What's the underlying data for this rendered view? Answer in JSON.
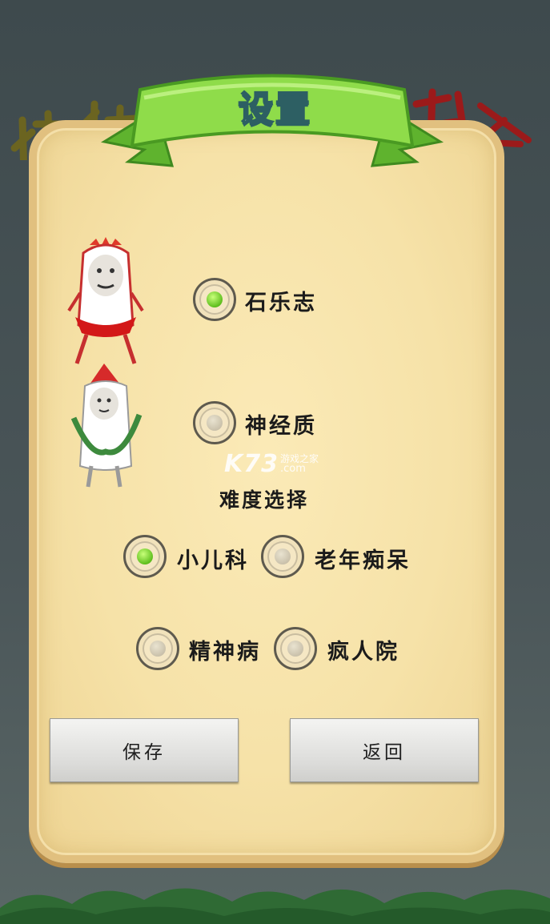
{
  "title": "设置",
  "background_text": "精神病人游戏",
  "characters": [
    {
      "name": "石乐志",
      "icon": "radish-character-crown-icon",
      "selected": true
    },
    {
      "name": "神经质",
      "icon": "radish-character-hat-icon",
      "selected": false
    }
  ],
  "watermark": {
    "brand": "K73",
    "tagline": "游戏之家",
    "domain": ".com"
  },
  "difficulty": {
    "heading": "难度选择",
    "options": [
      {
        "label": "小儿科",
        "selected": true
      },
      {
        "label": "老年痴呆",
        "selected": false
      },
      {
        "label": "精神病",
        "selected": false
      },
      {
        "label": "疯人院",
        "selected": false
      }
    ]
  },
  "buttons": {
    "save": "保存",
    "back": "返回"
  },
  "colors": {
    "panel": "#f6e2a8",
    "ribbon": "#7ccf3c",
    "selected": "#5fbf1e"
  }
}
